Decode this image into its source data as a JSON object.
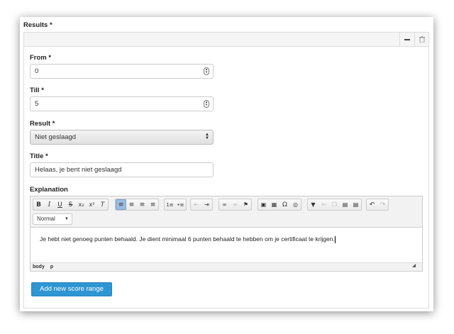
{
  "section_label": "Results *",
  "panel": {
    "minimize_icon": "minus-icon",
    "delete_icon": "trash-icon"
  },
  "from": {
    "label": "From *",
    "value": "0"
  },
  "till": {
    "label": "Till *",
    "value": "5"
  },
  "result": {
    "label": "Result *",
    "selected": "Niet geslaagd"
  },
  "title": {
    "label": "Title *",
    "value": "Helaas, je bent niet geslaagd"
  },
  "explanation": {
    "label": "Explanation",
    "format_select": "Normal",
    "content": "Je hebt niet genoeg punten behaald. Je dient minimaal 6 punten behaald te hebben om je certificaat te krijgen.",
    "path": [
      "body",
      "p"
    ],
    "toolbar_groups": [
      [
        "bold",
        "italic",
        "underline",
        "strikethrough",
        "subscript",
        "superscript",
        "remove-format"
      ],
      [
        "align-left",
        "align-center",
        "align-right",
        "justify"
      ],
      [
        "numbered-list",
        "bulleted-list"
      ],
      [
        "decrease-indent",
        "increase-indent"
      ],
      [
        "link",
        "unlink",
        "anchor"
      ],
      [
        "image",
        "table",
        "special-char",
        "iframe"
      ],
      [
        "paste-format",
        "cut",
        "copy",
        "paste",
        "paste-text"
      ],
      [
        "undo",
        "redo"
      ]
    ]
  },
  "add_button": "Add new score range",
  "colors": {
    "accent": "#2e95d3",
    "active_tool": "#9cbde0"
  }
}
